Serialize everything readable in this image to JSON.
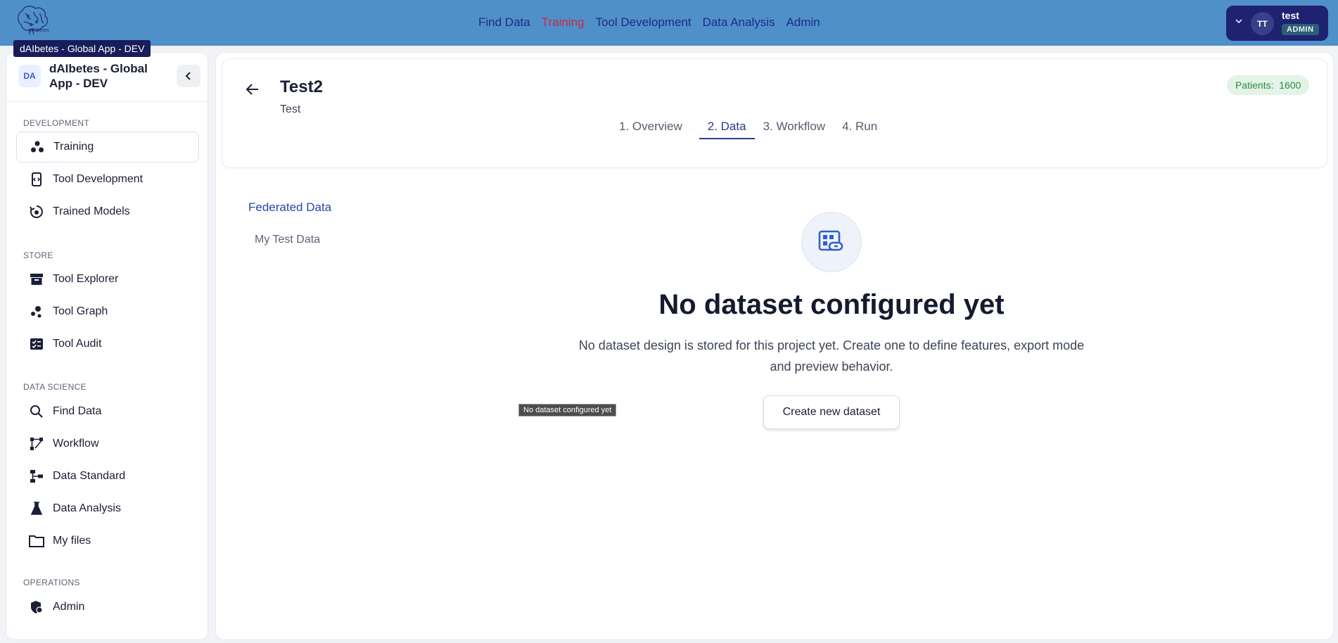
{
  "app": {
    "logo_text": "dAIbetes",
    "tooltip": "dAIbetes - Global App - DEV"
  },
  "topnav": {
    "items": [
      {
        "label": "Find Data"
      },
      {
        "label": "Training"
      },
      {
        "label": "Tool Development"
      },
      {
        "label": "Data Analysis"
      },
      {
        "label": "Admin"
      }
    ],
    "active_color": "#c8294a"
  },
  "user": {
    "initials": "TT",
    "name": "test",
    "role": "ADMIN"
  },
  "sidebar": {
    "badge": "DA",
    "title": "dAIbetes - Global App - DEV",
    "sections": [
      {
        "label": "DEVELOPMENT"
      },
      {
        "label": "STORE"
      },
      {
        "label": "DATA SCIENCE"
      },
      {
        "label": "OPERATIONS"
      }
    ],
    "items": [
      {
        "label": "Training",
        "icon": "training-icon"
      },
      {
        "label": "Tool Development",
        "icon": "tool-development-icon"
      },
      {
        "label": "Trained Models",
        "icon": "trained-models-icon"
      },
      {
        "label": "Tool Explorer",
        "icon": "archive-icon"
      },
      {
        "label": "Tool Graph",
        "icon": "graph-icon"
      },
      {
        "label": "Tool Audit",
        "icon": "audit-icon"
      },
      {
        "label": "Find Data",
        "icon": "search-icon"
      },
      {
        "label": "Workflow",
        "icon": "workflow-icon"
      },
      {
        "label": "Data Standard",
        "icon": "data-standard-icon"
      },
      {
        "label": "Data Analysis",
        "icon": "flask-icon"
      },
      {
        "label": "My files",
        "icon": "folder-icon"
      },
      {
        "label": "Admin",
        "icon": "admin-shield-icon"
      }
    ]
  },
  "project": {
    "title": "Test2",
    "subtitle": "Test",
    "patients_label": "Patients:",
    "patients_count": "1600",
    "tabs": [
      {
        "label": "1. Overview"
      },
      {
        "label": "2. Data"
      },
      {
        "label": "3. Workflow"
      },
      {
        "label": "4. Run"
      }
    ],
    "active_tab": "2. Data"
  },
  "data_panel": {
    "federated_title": "Federated Data",
    "items": [
      {
        "label": "My Test Data"
      }
    ]
  },
  "empty_state": {
    "title": "No dataset configured yet",
    "description": "No dataset design is stored for this project yet. Create one to define features, export mode and preview behavior.",
    "button_label": "Create new dataset",
    "hover_tooltip": "No dataset configured yet"
  },
  "colors": {
    "topbar": "#4f90c9",
    "accent": "#2a3a8c",
    "patients_bg": "#e3f3e7",
    "patients_text": "#2d8a45"
  }
}
